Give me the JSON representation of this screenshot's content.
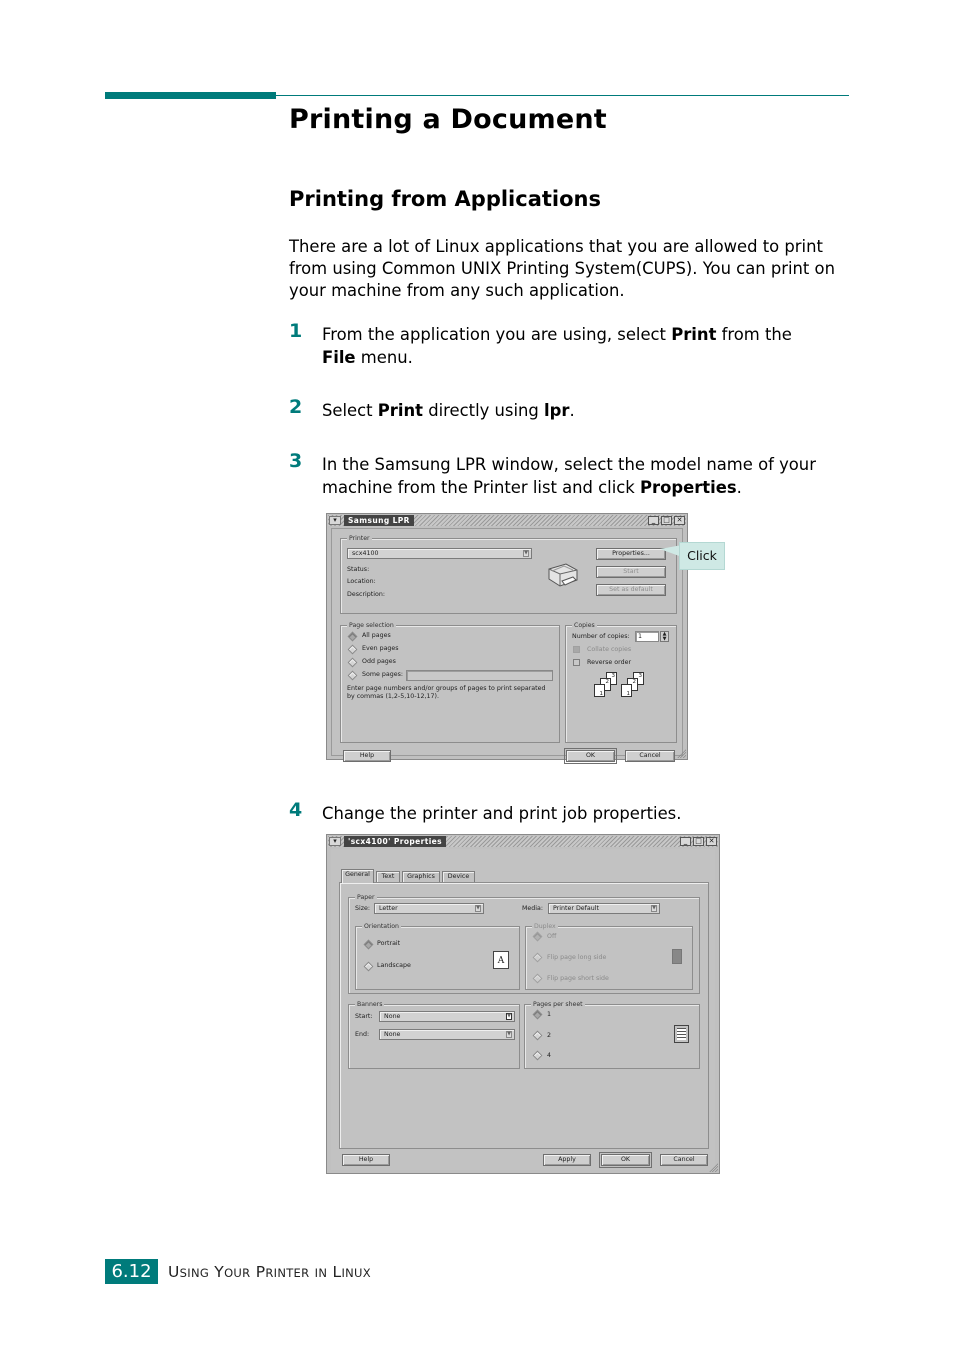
{
  "page": {
    "title": "Printing a Document",
    "subtitle": "Printing from Applications",
    "intro": "There are a lot of Linux applications that you are allowed to print from using Common UNIX Printing System(CUPS). You can print on your machine from any such application.",
    "accent_color": "#007b7b"
  },
  "steps": [
    {
      "num": "1",
      "parts": [
        "From the application you are using, select ",
        "Print",
        " from the ",
        "File",
        " menu."
      ]
    },
    {
      "num": "2",
      "parts": [
        "Select ",
        "Print",
        " directly using ",
        "lpr",
        "."
      ]
    },
    {
      "num": "3",
      "parts": [
        "In the Samsung LPR window, select the model name of your machine from the Printer list and click ",
        "Properties",
        "."
      ]
    },
    {
      "num": "4",
      "text": "Change the printer and print job properties."
    }
  ],
  "lpr_window": {
    "title": "Samsung LPR",
    "printer_frame": "Printer",
    "printer_value": "scx4100",
    "status_label": "Status:",
    "location_label": "Location:",
    "description_label": "Description:",
    "properties_button": "Properties...",
    "start_button": "Start",
    "set_default_button": "Set as default",
    "page_selection_frame": "Page selection",
    "page_options": [
      "All pages",
      "Even pages",
      "Odd pages",
      "Some pages:"
    ],
    "page_hint": "Enter page numbers and/or groups of pages to print separated by commas (1,2-5,10-12,17).",
    "copies_frame": "Copies",
    "copies_label": "Number of copies:",
    "copies_value": "1",
    "collate_label": "Collate copies",
    "reverse_label": "Reverse order",
    "stack_numbers": [
      "3",
      "2",
      "1"
    ],
    "help_button": "Help",
    "ok_button": "OK",
    "cancel_button": "Cancel",
    "callout": "Click"
  },
  "props_window": {
    "title": "'scx4100' Properties",
    "tabs": [
      "General",
      "Text",
      "Graphics",
      "Device"
    ],
    "paper_frame": "Paper",
    "size_label": "Size:",
    "size_value": "Letter",
    "media_label": "Media:",
    "media_value": "Printer Default",
    "orientation_frame": "Orientation",
    "orientation_options": [
      "Portrait",
      "Landscape"
    ],
    "orientation_glyph": "A",
    "duplex_frame": "Duplex",
    "duplex_options": [
      "Off",
      "Flip page long side",
      "Flip page short side"
    ],
    "banners_frame": "Banners",
    "start_label": "Start:",
    "start_value": "None",
    "end_label": "End:",
    "end_value": "None",
    "pages_per_sheet_frame": "Pages per sheet",
    "pages_per_sheet_options": [
      "1",
      "2",
      "4"
    ],
    "help_button": "Help",
    "apply_button": "Apply",
    "ok_button": "OK",
    "cancel_button": "Cancel"
  },
  "footer": {
    "page_number": "6.12",
    "chapter_parts": [
      [
        "U",
        "SING"
      ],
      [
        "Y",
        "OUR"
      ],
      [
        "P",
        "RINTER"
      ],
      [
        "",
        "IN"
      ],
      [
        "L",
        "INUX"
      ]
    ]
  }
}
